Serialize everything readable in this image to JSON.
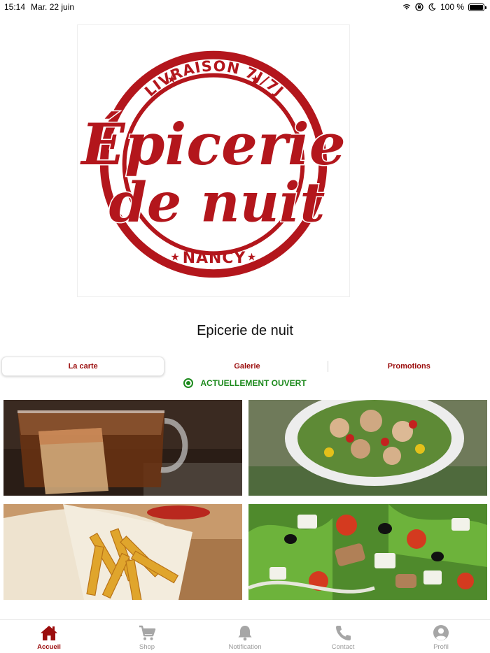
{
  "status_bar": {
    "time": "15:14",
    "date": "Mar. 22 juin",
    "battery": "100 %"
  },
  "logo": {
    "top_text": "LIVRAISON 7J/7J",
    "line1": "Épicerie",
    "line2": "de nuit",
    "bottom_text": "NANCY",
    "color": "#b3161c"
  },
  "store": {
    "name": "Epicerie de nuit"
  },
  "tabs": [
    {
      "label": "La carte",
      "active": true
    },
    {
      "label": "Galerie",
      "active": false
    },
    {
      "label": "Promotions",
      "active": false
    }
  ],
  "open_status": {
    "text": "ACTUELLEMENT OUVERT",
    "color": "#1d8a1d"
  },
  "gallery": [
    {
      "icon": "tea-photo"
    },
    {
      "icon": "chicken-salad-photo"
    },
    {
      "icon": "fries-photo"
    },
    {
      "icon": "mixed-salad-photo"
    }
  ],
  "bottom_nav": [
    {
      "label": "Accueil",
      "icon": "home-icon",
      "active": true
    },
    {
      "label": "Shop",
      "icon": "cart-icon",
      "active": false
    },
    {
      "label": "Notification",
      "icon": "bell-icon",
      "active": false
    },
    {
      "label": "Contact",
      "icon": "phone-icon",
      "active": false
    },
    {
      "label": "Profil",
      "icon": "profile-icon",
      "active": false
    }
  ],
  "colors": {
    "accent": "#9b0d0d",
    "inactive": "#9a9a9a",
    "open": "#1d8a1d"
  }
}
